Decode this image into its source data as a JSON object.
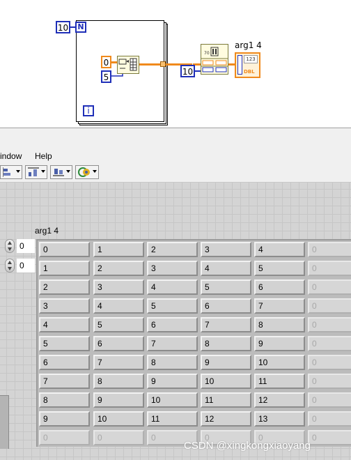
{
  "diagram": {
    "loop_count_constant": "10",
    "loop_count_terminal": "N",
    "iteration_terminal": "i",
    "init_constant": "0",
    "size_constant": "5",
    "bundle_constant": "10",
    "indicator_label": "arg1 4",
    "indicator_type": "DBL",
    "indicator_header": "123"
  },
  "menubar": {
    "items": [
      "indow",
      "Help"
    ]
  },
  "toolbar": {
    "buttons": [
      "align-objects",
      "distribute-objects",
      "resize-objects",
      "reorder"
    ]
  },
  "panel": {
    "array_label": "arg1 4",
    "index_row": "0",
    "index_col": "0",
    "rows": [
      [
        "0",
        "1",
        "2",
        "3",
        "4",
        "0"
      ],
      [
        "1",
        "2",
        "3",
        "4",
        "5",
        "0"
      ],
      [
        "2",
        "3",
        "4",
        "5",
        "6",
        "0"
      ],
      [
        "3",
        "4",
        "5",
        "6",
        "7",
        "0"
      ],
      [
        "4",
        "5",
        "6",
        "7",
        "8",
        "0"
      ],
      [
        "5",
        "6",
        "7",
        "8",
        "9",
        "0"
      ],
      [
        "6",
        "7",
        "8",
        "9",
        "10",
        "0"
      ],
      [
        "7",
        "8",
        "9",
        "10",
        "11",
        "0"
      ],
      [
        "8",
        "9",
        "10",
        "11",
        "12",
        "0"
      ],
      [
        "9",
        "10",
        "11",
        "12",
        "13",
        "0"
      ],
      [
        "0",
        "0",
        "0",
        "0",
        "0",
        "0"
      ]
    ],
    "active_rows": 10,
    "active_cols": 5
  },
  "watermark": "CSDN @xingkongxiaoyang"
}
